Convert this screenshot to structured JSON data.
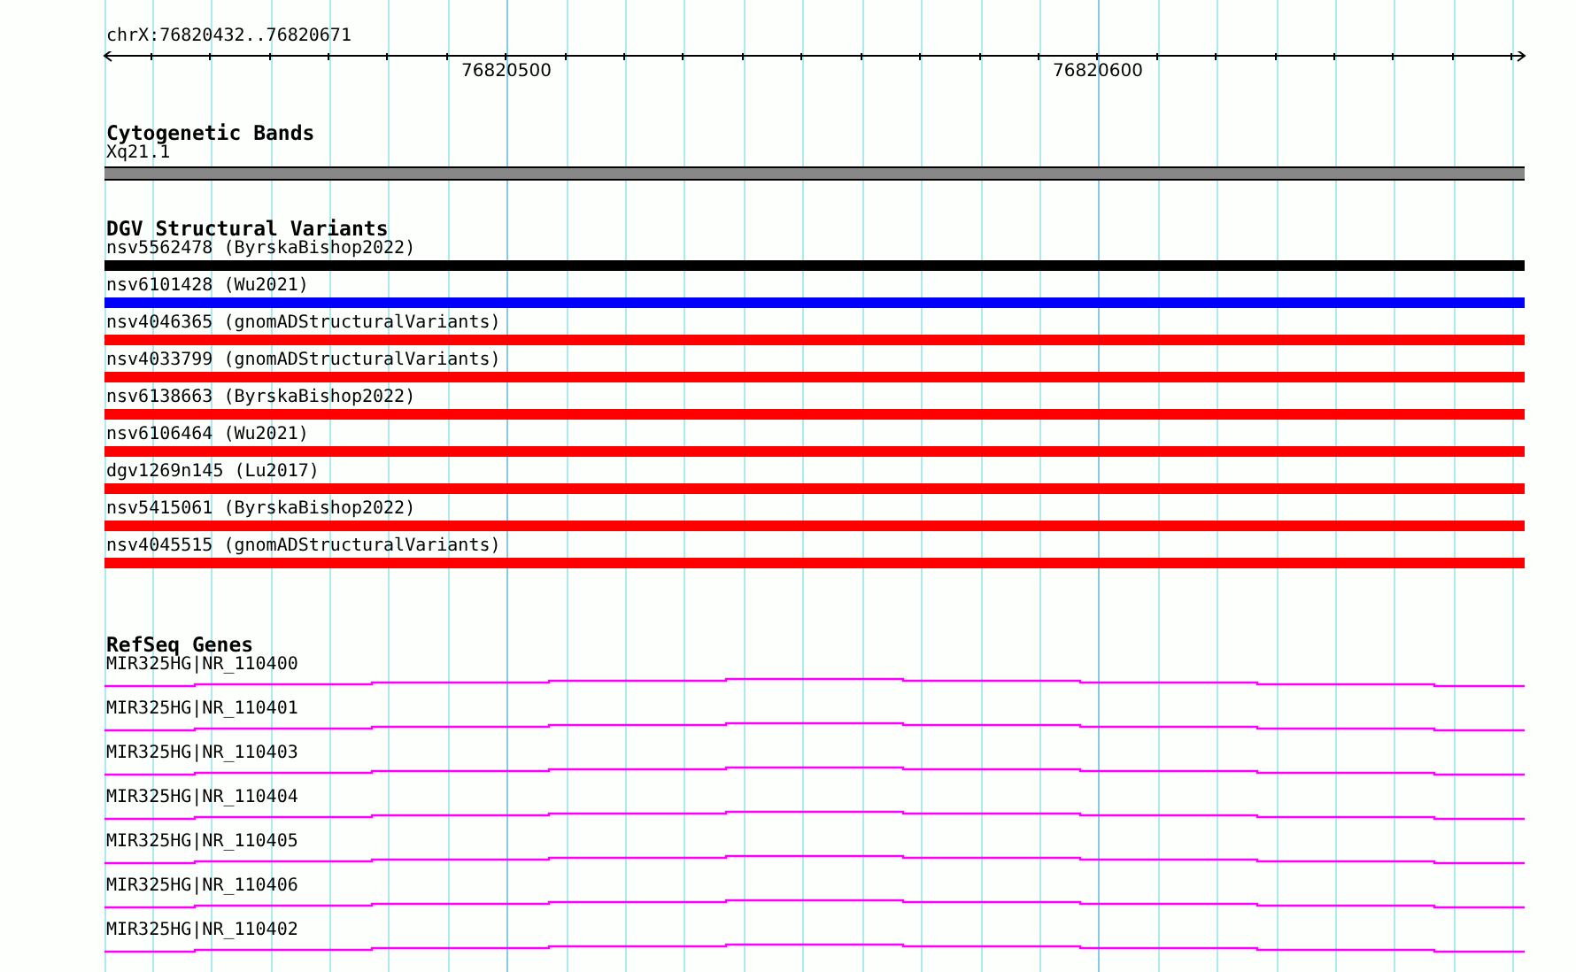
{
  "position_label": "chrX:76820432..76820671",
  "ruler": {
    "tick_labels": [
      "76820500",
      "76820600"
    ]
  },
  "tracks": [
    {
      "kind": "cytoband",
      "title": "Cytogenetic Bands",
      "features": [
        {
          "label": "Xq21.1"
        }
      ]
    },
    {
      "kind": "variants",
      "title": "DGV Structural Variants",
      "features": [
        {
          "label": "nsv5562478 (ByrskaBishop2022)",
          "color": "#000000"
        },
        {
          "label": "nsv6101428 (Wu2021)",
          "color": "#0000ff"
        },
        {
          "label": "nsv4046365 (gnomADStructuralVariants)",
          "color": "#ff0000"
        },
        {
          "label": "nsv4033799 (gnomADStructuralVariants)",
          "color": "#ff0000"
        },
        {
          "label": "nsv6138663 (ByrskaBishop2022)",
          "color": "#ff0000"
        },
        {
          "label": "nsv6106464 (Wu2021)",
          "color": "#ff0000"
        },
        {
          "label": "dgv1269n145 (Lu2017)",
          "color": "#ff0000"
        },
        {
          "label": "nsv5415061 (ByrskaBishop2022)",
          "color": "#ff0000"
        },
        {
          "label": "nsv4045515 (gnomADStructuralVariants)",
          "color": "#ff0000"
        }
      ]
    },
    {
      "kind": "genes",
      "title": "RefSeq Genes",
      "features": [
        {
          "label": "MIR325HG|NR_110400"
        },
        {
          "label": "MIR325HG|NR_110401"
        },
        {
          "label": "MIR325HG|NR_110403"
        },
        {
          "label": "MIR325HG|NR_110404"
        },
        {
          "label": "MIR325HG|NR_110405"
        },
        {
          "label": "MIR325HG|NR_110406"
        },
        {
          "label": "MIR325HG|NR_110402"
        }
      ]
    }
  ]
}
